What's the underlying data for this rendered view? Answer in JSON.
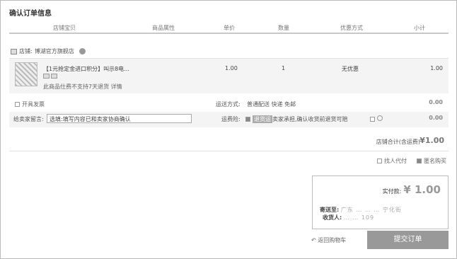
{
  "page_title": "确认订单信息",
  "columns": [
    "店铺宝贝",
    "商品属性",
    "单价",
    "数量",
    "优惠方式",
    "小计"
  ],
  "shop": {
    "label": "店铺:",
    "name": "博湖官方旗舰店"
  },
  "item": {
    "name": "【1元抢定金进口积分】叫示8电...",
    "note": "此商品仕费不支持7天退货 详情",
    "price": "1.00",
    "quantity": "1",
    "discount": "无优惠",
    "subtotal": "1.00"
  },
  "invoice": {
    "label": "开具发票",
    "shipping_label": "运送方式:",
    "shipping_value": "普通配送 快递 免邮",
    "amount": "0.00"
  },
  "message": {
    "label": "给卖家留言:",
    "value": "选填:填写内容已和卖家协商确认",
    "insurance_label": "运费险:",
    "insurance_tag": "退货运",
    "insurance_text": "卖家承担,确认收货前退货可赔",
    "amount": "0.00"
  },
  "shop_total": {
    "label": "店铺合计(含运费)",
    "value": "¥1.00"
  },
  "options": {
    "friend_pay": "找人代付",
    "anonymous": "匿名购买"
  },
  "payment": {
    "actual_label": "实付款:",
    "actual_value": "¥ 1.00",
    "ship_to_label": "寄送至:",
    "ship_to_value": "广东 … … … 宁化街",
    "recipient_label": "收货人:",
    "recipient_value": "… … 109"
  },
  "back_link": "返回购物车",
  "submit_label": "提交订单"
}
